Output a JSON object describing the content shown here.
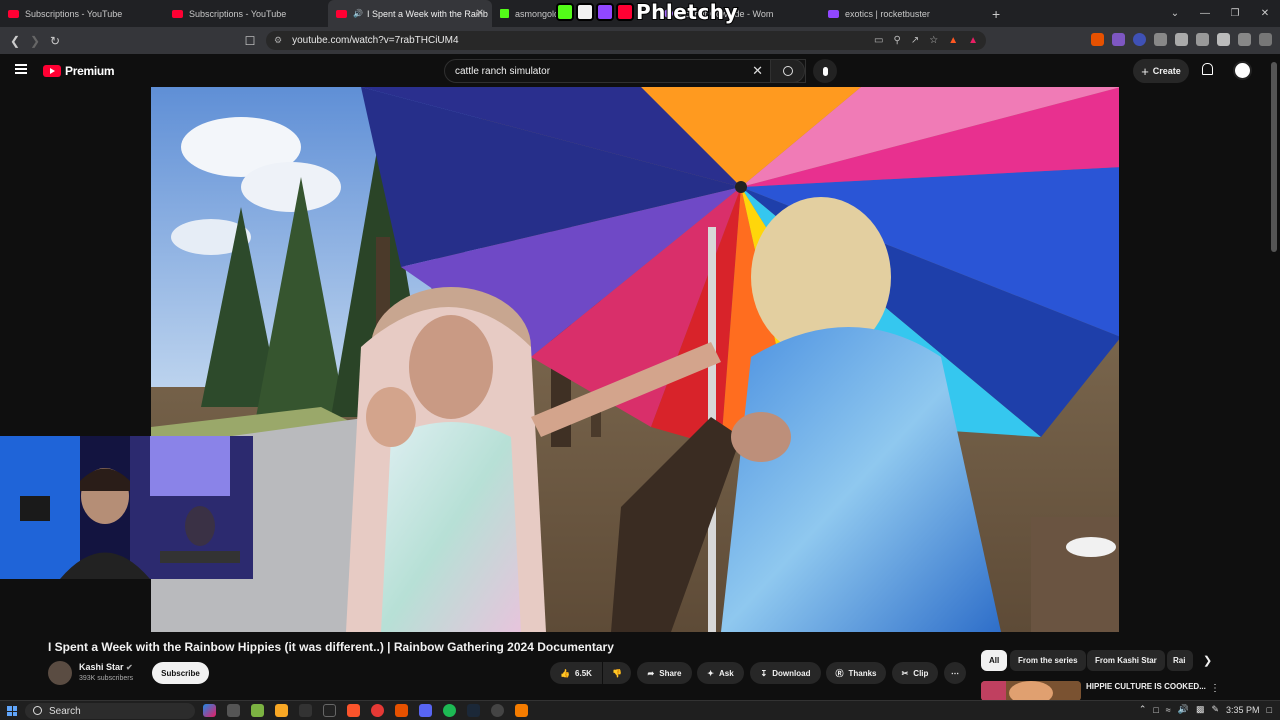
{
  "browser": {
    "tabs": [
      {
        "title": "Subscriptions - YouTube",
        "icon": "youtube-icon"
      },
      {
        "title": "Subscriptions - YouTube",
        "icon": "youtube-icon"
      },
      {
        "title": "I Spent a Week with the Rainb",
        "icon": "youtube-icon",
        "active": true
      },
      {
        "title": "asmongold",
        "icon": "kick-icon"
      },
      {
        "title": "Scarlet Cowhide - Wom",
        "icon": "tab-icon"
      },
      {
        "title": "exotics | rocketbuster",
        "icon": "rocketbuster-icon"
      }
    ],
    "url": "youtube.com/watch?v=7rabTHCiUM4",
    "overlay_logo_text": "Phletchy"
  },
  "youtube": {
    "logo_text": "Premium",
    "search_query": "cattle ranch simulator",
    "create_label": "Create"
  },
  "video": {
    "title": "I Spent a Week with the Rainbow Hippies (it was different..) | Rainbow Gathering 2024 Documentary",
    "channel_name": "Kashi Star",
    "channel_subs": "393K subscribers",
    "subscribe_label": "Subscribe",
    "like_count": "6.5K",
    "share_label": "Share",
    "ask_label": "Ask",
    "download_label": "Download",
    "thanks_label": "Thanks",
    "clip_label": "Clip"
  },
  "sidebar": {
    "chips": [
      "All",
      "From the series",
      "From Kashi Star",
      "Rai"
    ],
    "rec_title": "HIPPIE CULTURE IS COOKED..."
  },
  "taskbar": {
    "search_label": "Search",
    "time": "3:35 PM"
  }
}
